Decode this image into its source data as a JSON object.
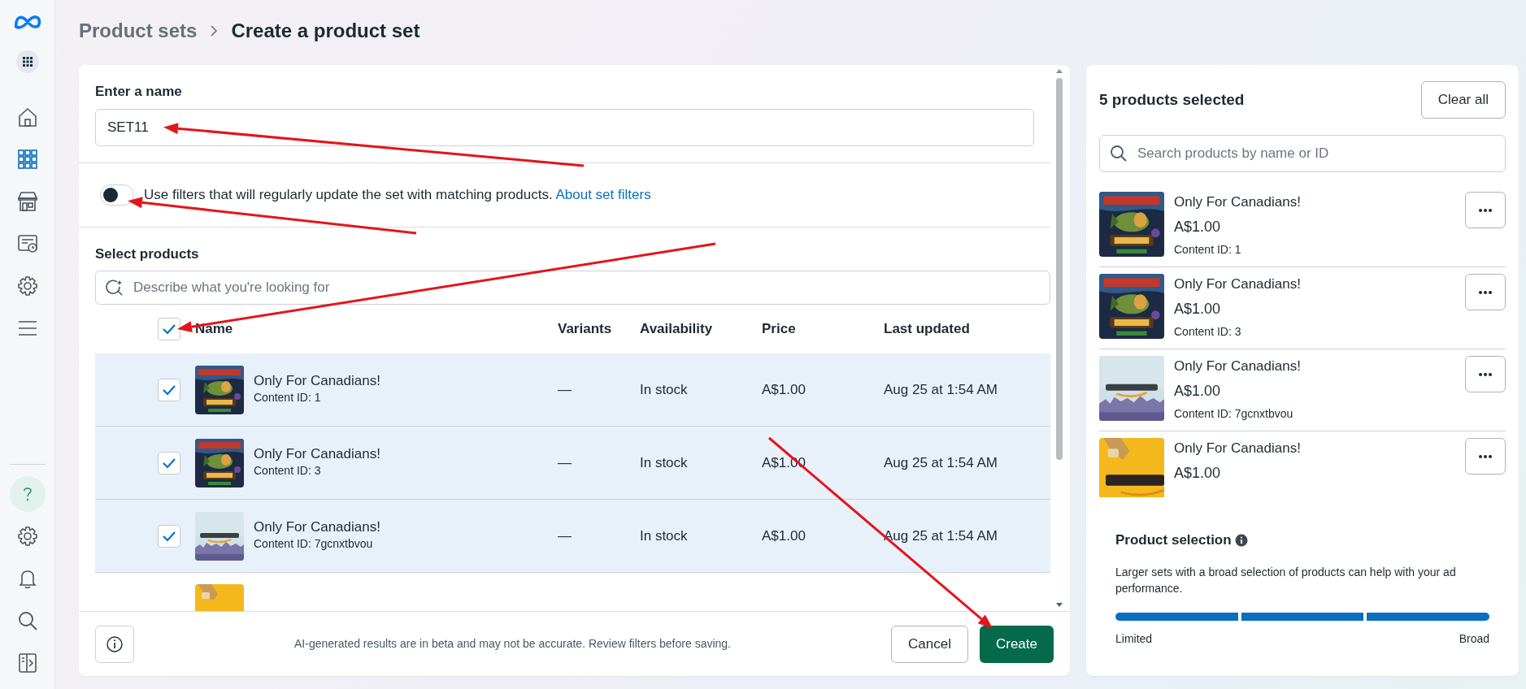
{
  "sidebar": {
    "items": [
      {
        "kind": "home",
        "selected": false
      },
      {
        "kind": "catalog",
        "selected": true
      },
      {
        "kind": "shop",
        "selected": false
      },
      {
        "kind": "events",
        "selected": false
      },
      {
        "kind": "settings",
        "selected": false
      },
      {
        "kind": "menu",
        "selected": false
      }
    ],
    "bottom_items": [
      {
        "kind": "help",
        "selected": true
      },
      {
        "kind": "settings",
        "selected": false
      },
      {
        "kind": "bell",
        "selected": false
      },
      {
        "kind": "search",
        "selected": false
      },
      {
        "kind": "panel",
        "selected": false
      }
    ]
  },
  "breadcrumb": [
    {
      "label": "Product sets",
      "current": false
    },
    {
      "label": "Create a product set",
      "current": true
    }
  ],
  "name_section": {
    "label": "Enter a name",
    "value": "SET11"
  },
  "filter_toggle": {
    "on": false,
    "text": "Use filters that will regularly update the set with matching products.",
    "link": "About set filters"
  },
  "select_section": {
    "title": "Select products",
    "search_placeholder": "Describe what you're looking for",
    "select_all_checked": true,
    "columns": [
      "Name",
      "Variants",
      "Availability",
      "Price",
      "Last updated"
    ],
    "rows": [
      {
        "checked": true,
        "selected": true,
        "name": "Only For Canadians!",
        "content_id": "Content ID: 1",
        "variants": "—",
        "availability": "In stock",
        "price": "A$1.00",
        "updated": "Aug 25 at 1:54 AM"
      },
      {
        "checked": true,
        "selected": true,
        "name": "Only For Canadians!",
        "content_id": "Content ID: 3",
        "variants": "—",
        "availability": "In stock",
        "price": "A$1.00",
        "updated": "Aug 25 at 1:54 AM"
      },
      {
        "checked": true,
        "selected": true,
        "name": "Only For Canadians!",
        "content_id": "Content ID: 7gcnxtbvou",
        "variants": "—",
        "availability": "In stock",
        "price": "A$1.00",
        "updated": "Aug 25 at 1:54 AM"
      },
      {
        "selected": false
      }
    ]
  },
  "footer": {
    "note": "AI-generated results are in beta and may not be accurate. Review filters before saving.",
    "buttons": [
      {
        "label": "Cancel",
        "kind": "secondary"
      },
      {
        "label": "Create",
        "kind": "primary"
      }
    ]
  },
  "selected_panel": {
    "title": "5 products selected",
    "clear_button": "Clear all",
    "search_placeholder": "Search products by name or ID",
    "items": [
      {
        "name": "Only For Canadians!",
        "price": "A$1.00",
        "content_id": "Content ID: 1"
      },
      {
        "name": "Only For Canadians!",
        "price": "A$1.00",
        "content_id": "Content ID: 3"
      },
      {
        "name": "Only For Canadians!",
        "price": "A$1.00",
        "content_id": "Content ID: 7gcnxtbvou"
      },
      {
        "name": "Only For Canadians!",
        "price": "A$1.00"
      }
    ]
  },
  "product_selection": {
    "title": "Product selection",
    "text": "Larger sets with a broad selection of products can help with your ad performance.",
    "level": 1,
    "low_label": "Limited",
    "high_label": "Broad"
  },
  "annotation_arrows": [
    {
      "kind": "arrow"
    },
    {
      "kind": "arrow"
    },
    {
      "kind": "arrow"
    },
    {
      "kind": "arrow"
    }
  ]
}
